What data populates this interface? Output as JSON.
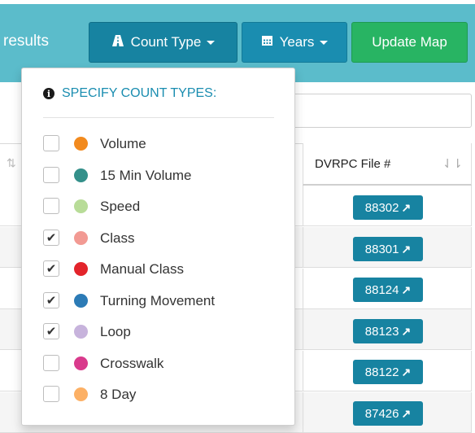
{
  "toolbar": {
    "results_label": "results",
    "count_type_label": "Count Type",
    "years_label": "Years",
    "update_map_label": "Update Map"
  },
  "table": {
    "header_file": "DVRPC File #",
    "file_numbers": [
      "88302",
      "88301",
      "88124",
      "88123",
      "88122",
      "87426"
    ]
  },
  "dropdown": {
    "header": "SPECIFY COUNT TYPES:",
    "items": [
      {
        "label": "Volume",
        "checked": false,
        "color": "#f28a1e"
      },
      {
        "label": "15 Min Volume",
        "checked": false,
        "color": "#34908a"
      },
      {
        "label": "Speed",
        "checked": false,
        "color": "#b8dc98"
      },
      {
        "label": "Class",
        "checked": true,
        "color": "#f29a93"
      },
      {
        "label": "Manual Class",
        "checked": true,
        "color": "#e3242b"
      },
      {
        "label": "Turning Movement",
        "checked": true,
        "color": "#2c7bb6"
      },
      {
        "label": "Loop",
        "checked": true,
        "color": "#c7b3dc"
      },
      {
        "label": "Crosswalk",
        "checked": false,
        "color": "#d93a8c"
      },
      {
        "label": "8 Day",
        "checked": false,
        "color": "#fcb065"
      }
    ]
  },
  "icons": {
    "checkmark": "✔",
    "external_link": "↗"
  }
}
